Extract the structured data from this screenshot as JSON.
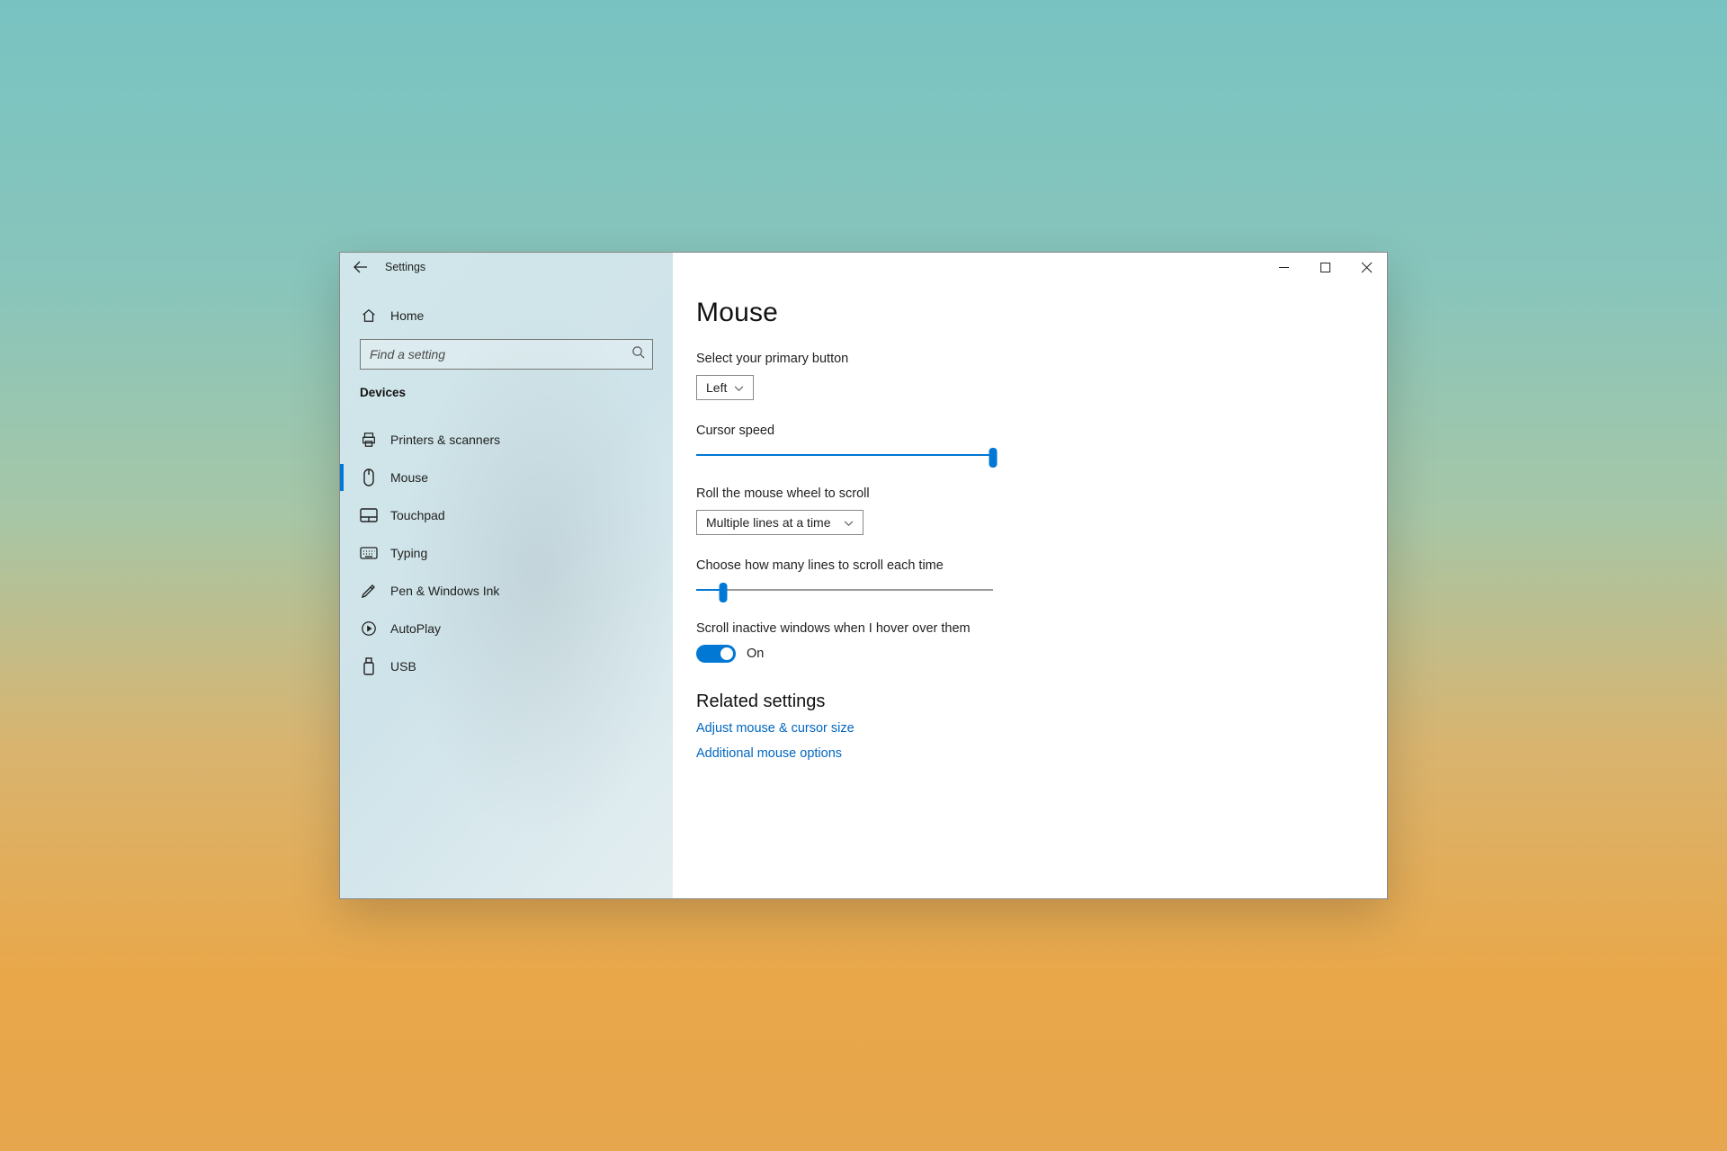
{
  "window": {
    "title": "Settings"
  },
  "sidebar": {
    "home_label": "Home",
    "search_placeholder": "Find a setting",
    "category_header": "Devices",
    "items": [
      {
        "label": "Printers & scanners"
      },
      {
        "label": "Mouse"
      },
      {
        "label": "Touchpad"
      },
      {
        "label": "Typing"
      },
      {
        "label": "Pen & Windows Ink"
      },
      {
        "label": "AutoPlay"
      },
      {
        "label": "USB"
      }
    ],
    "active_index": 1
  },
  "main": {
    "title": "Mouse",
    "primary_button": {
      "label": "Select your primary button",
      "value": "Left"
    },
    "cursor_speed": {
      "label": "Cursor speed",
      "value_percent": 100
    },
    "wheel_scroll": {
      "label": "Roll the mouse wheel to scroll",
      "value": "Multiple lines at a time"
    },
    "lines_each_time": {
      "label": "Choose how many lines to scroll each time",
      "value_percent": 9
    },
    "scroll_inactive": {
      "label": "Scroll inactive windows when I hover over them",
      "state_label": "On",
      "on": true
    },
    "related": {
      "header": "Related settings",
      "links": [
        "Adjust mouse & cursor size",
        "Additional mouse options"
      ]
    }
  }
}
